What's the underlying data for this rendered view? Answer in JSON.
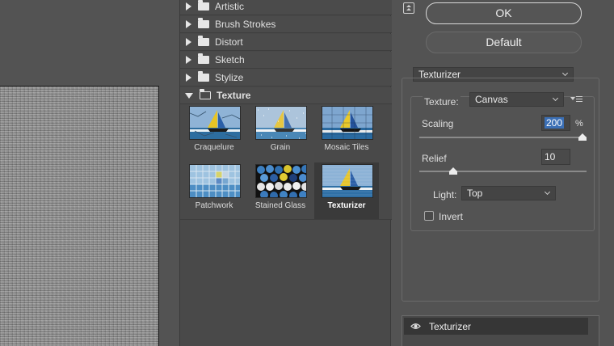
{
  "gallery": {
    "folders": [
      {
        "label": "Artistic"
      },
      {
        "label": "Brush Strokes"
      },
      {
        "label": "Distort"
      },
      {
        "label": "Sketch"
      },
      {
        "label": "Stylize"
      },
      {
        "label": "Texture",
        "open": true
      }
    ],
    "thumbnails": [
      {
        "label": "Craquelure"
      },
      {
        "label": "Grain"
      },
      {
        "label": "Mosaic Tiles"
      },
      {
        "label": "Patchwork"
      },
      {
        "label": "Stained Glass"
      },
      {
        "label": "Texturizer",
        "selected": true
      }
    ]
  },
  "actions": {
    "ok_label": "OK",
    "default_label": "Default"
  },
  "filter": {
    "selected": "Texturizer",
    "texture_label": "Texture:",
    "texture_value": "Canvas",
    "scaling_label": "Scaling",
    "scaling_value": "200",
    "scaling_unit": "%",
    "scaling_fraction": 1.0,
    "relief_label": "Relief",
    "relief_value": "10",
    "relief_fraction": 0.2,
    "light_label": "Light:",
    "light_value": "Top",
    "invert_label": "Invert",
    "invert_checked": false
  },
  "layers": [
    {
      "name": "Texturizer",
      "visible": true
    }
  ],
  "colors": {
    "panel_bg": "#535353",
    "gallery_bg": "#494949",
    "selection_blue": "#3b6fb5"
  }
}
